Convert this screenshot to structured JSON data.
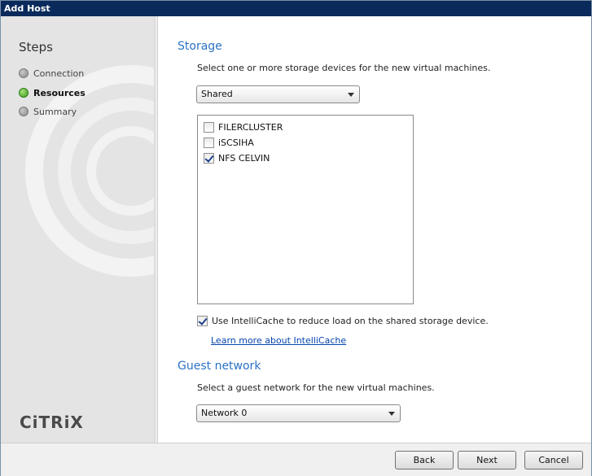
{
  "window": {
    "title": "Add Host"
  },
  "sidebar": {
    "steps_title": "Steps",
    "steps": [
      {
        "label": "Connection",
        "state": "complete"
      },
      {
        "label": "Resources",
        "state": "active"
      },
      {
        "label": "Summary",
        "state": "pending"
      }
    ],
    "logo": "CiTRiX"
  },
  "storage": {
    "title": "Storage",
    "description": "Select one or more storage devices for the new virtual machines.",
    "type_selected": "Shared",
    "devices": [
      {
        "label": "FILERCLUSTER",
        "checked": false
      },
      {
        "label": "iSCSIHA",
        "checked": false
      },
      {
        "label": "NFS CELVIN",
        "checked": true
      }
    ],
    "intellicache_label": "Use IntelliCache to reduce load on the shared storage device.",
    "intellicache_checked": true,
    "learn_more": "Learn more about IntelliCache"
  },
  "guest_network": {
    "title": "Guest network",
    "description": "Select a guest network for the new virtual machines.",
    "selected": "Network 0"
  },
  "footer": {
    "back_label": "Back",
    "next_label": "Next",
    "cancel_label": "Cancel"
  },
  "colors": {
    "title_bar": "#0a2a5c",
    "section_title": "#2a72c4",
    "link": "#0645ad",
    "step_active": "#3c9a1d"
  }
}
